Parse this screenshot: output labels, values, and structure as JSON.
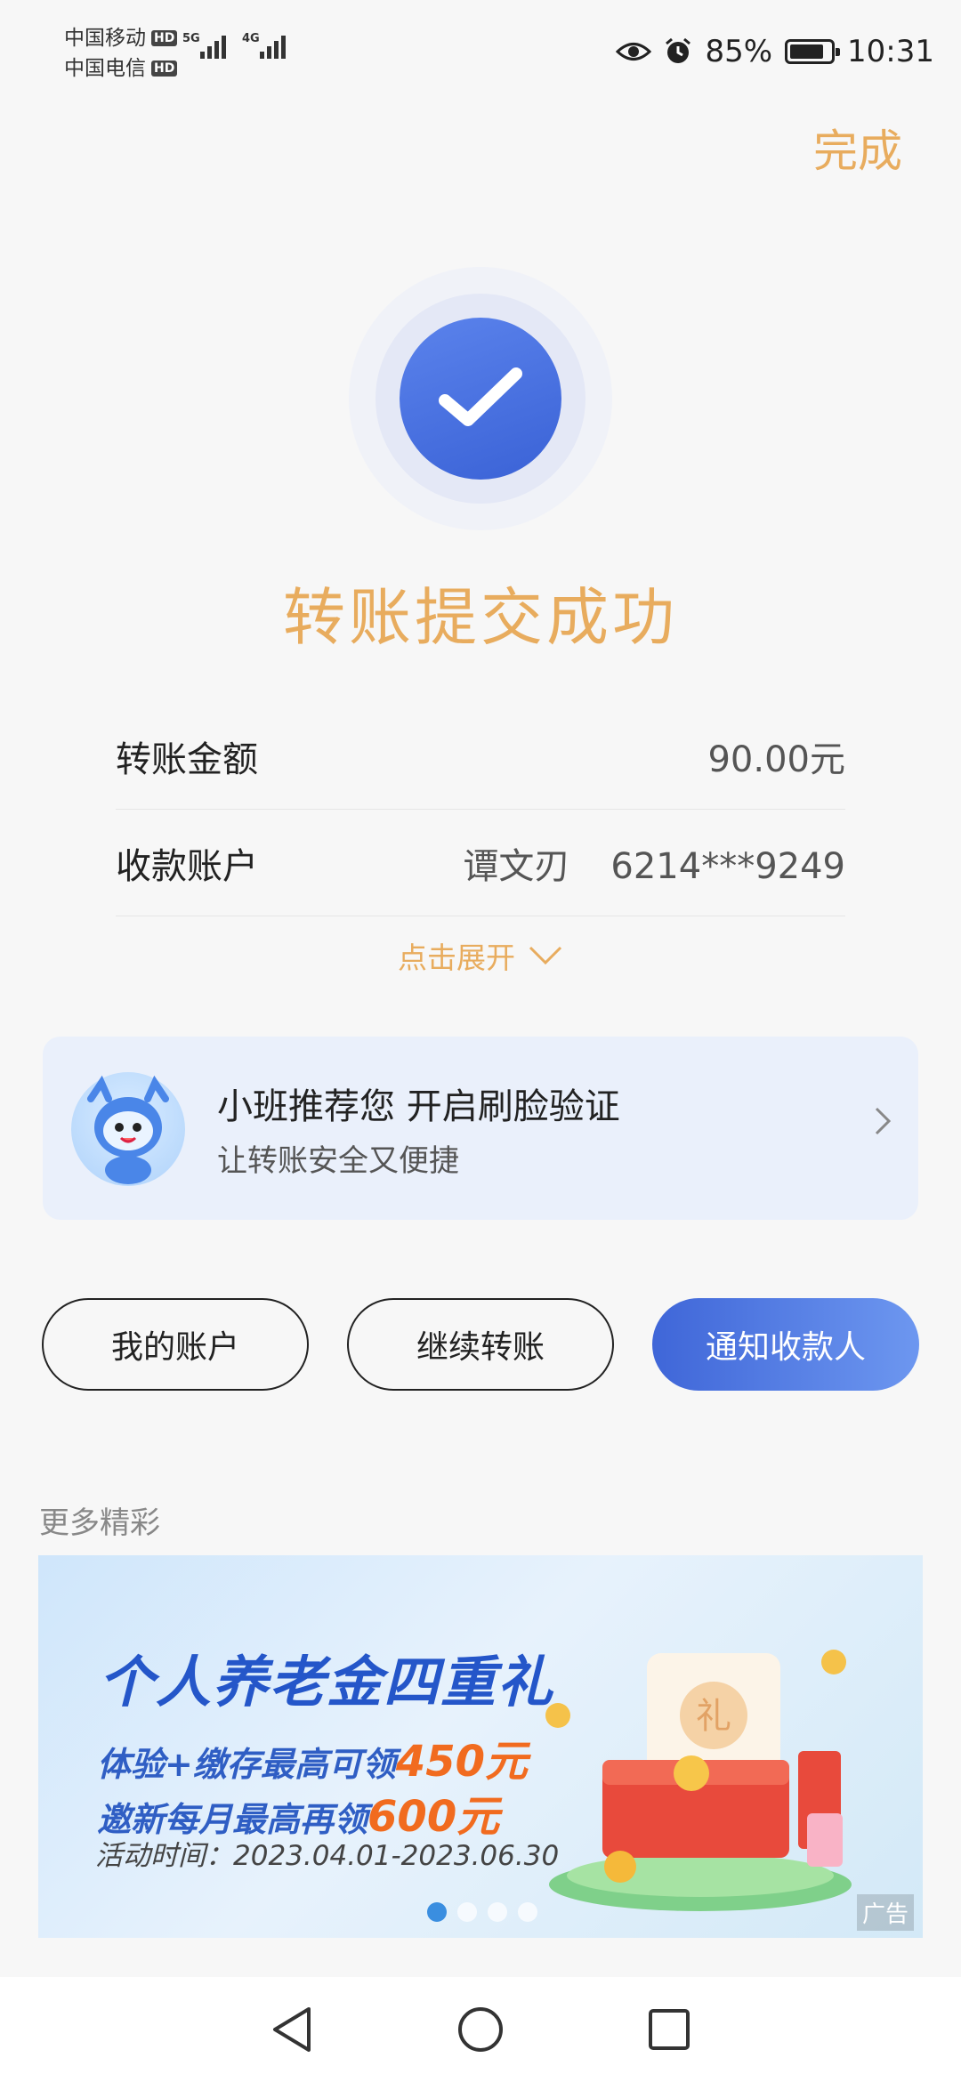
{
  "status_bar": {
    "carrier_1": "中国移动",
    "carrier_2": "中国电信",
    "hd_badge": "HD",
    "net_1": "5G",
    "net_2": "4G",
    "battery_percent": "85%",
    "battery_level": 0.85,
    "time": "10:31"
  },
  "header": {
    "done_label": "完成"
  },
  "result": {
    "title": "转账提交成功"
  },
  "details": {
    "amount_label": "转账金额",
    "amount_value": "90.00元",
    "account_label": "收款账户",
    "payee_name": "谭文刃",
    "payee_account": "6214***9249",
    "expand_label": "点击展开"
  },
  "promo": {
    "title": "小班推荐您 开启刷脸验证",
    "subtitle": "让转账安全又便捷"
  },
  "actions": {
    "my_account": "我的账户",
    "continue_transfer": "继续转账",
    "notify_payee": "通知收款人"
  },
  "more": {
    "section_label": "更多精彩",
    "banner": {
      "headline": "个人养老金四重礼",
      "line1_prefix": "体验+缴存最高可领",
      "line1_amount": "450元",
      "line2_prefix": "邀新每月最高再领",
      "line2_amount": "600元",
      "date": "活动时间：2023.04.01-2023.06.30",
      "gift_char": "礼",
      "ad_tag": "广告",
      "active_slide": 1,
      "slide_count": 4
    }
  },
  "colors": {
    "accent_gold": "#e8ac5e",
    "primary_blue": "#3f66d8",
    "promo_bg": "#eaf0fb"
  },
  "icons": {
    "success": "check-circle-icon",
    "expand": "chevron-down-icon",
    "promo_arrow": "chevron-right-icon",
    "nav_back": "triangle-back-icon",
    "nav_home": "circle-home-icon",
    "nav_recent": "square-recent-icon"
  }
}
